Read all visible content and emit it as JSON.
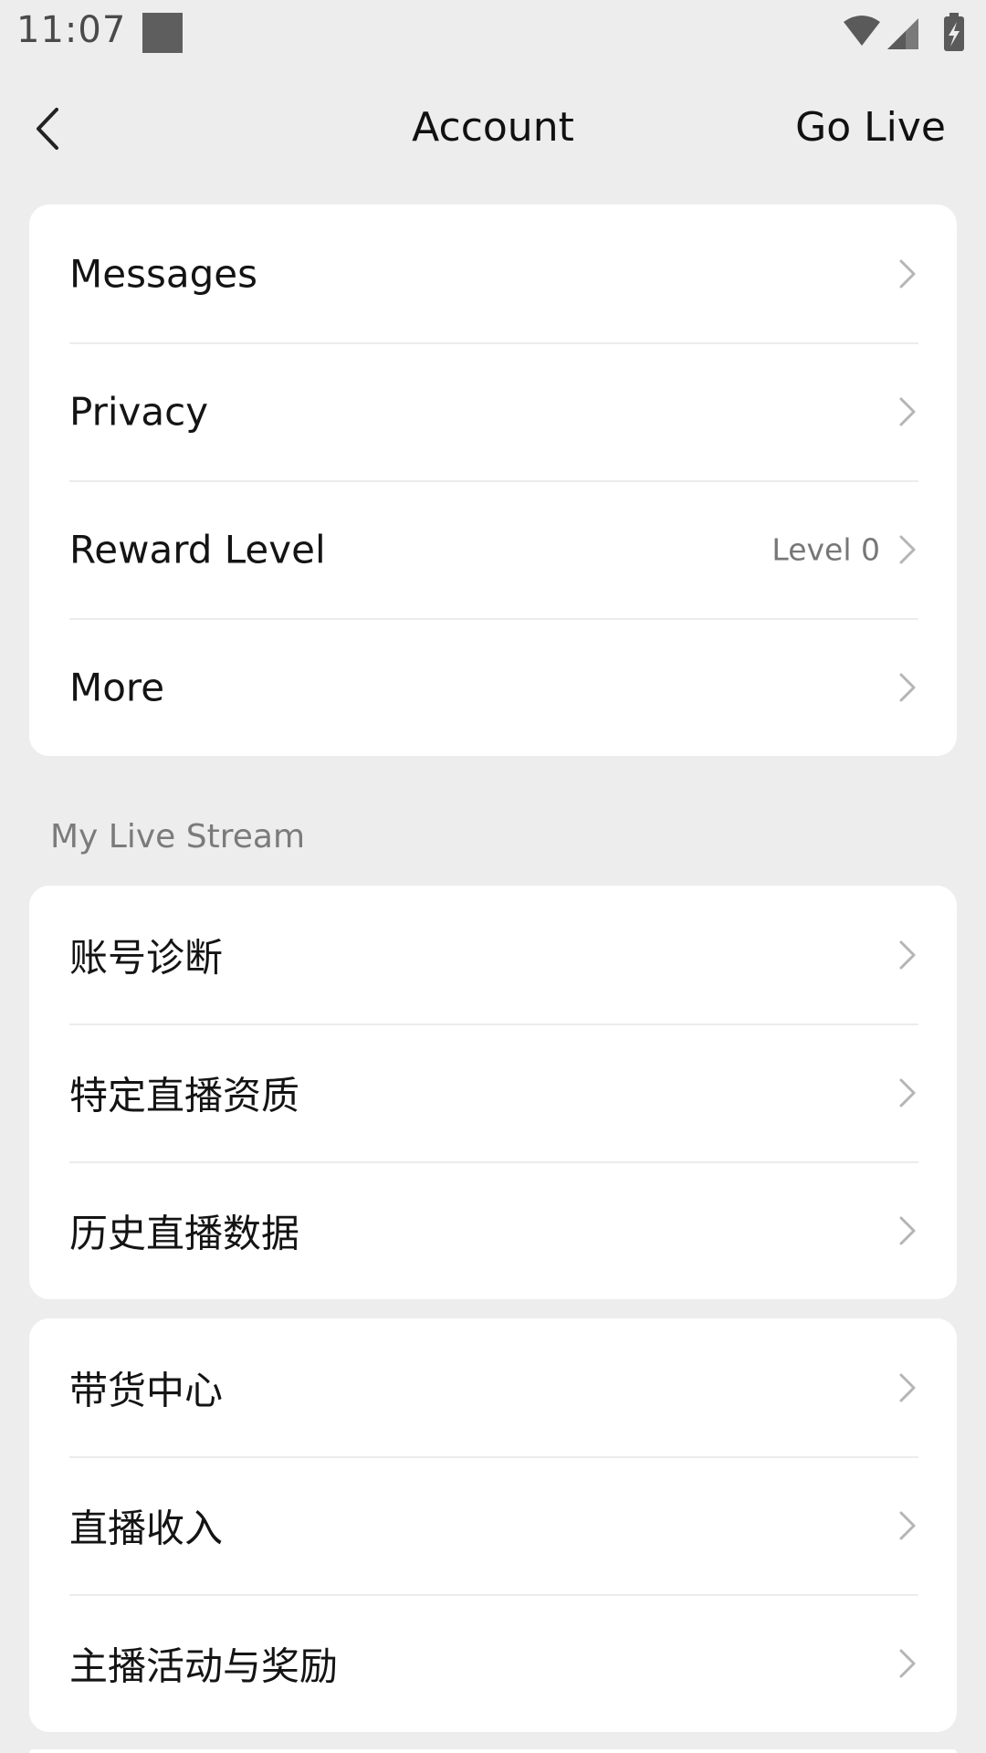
{
  "status_bar": {
    "time": "11:07"
  },
  "nav": {
    "back_icon": "chevron-left-icon",
    "title": "Account",
    "action": "Go Live"
  },
  "account_card": [
    {
      "label": "Messages",
      "value": ""
    },
    {
      "label": "Privacy",
      "value": ""
    },
    {
      "label": "Reward Level",
      "value": "Level 0"
    },
    {
      "label": "More",
      "value": ""
    }
  ],
  "section": {
    "title": "My Live Stream"
  },
  "live_card": [
    {
      "label": "账号诊断"
    },
    {
      "label": "特定直播资质"
    },
    {
      "label": "历史直播数据"
    }
  ],
  "commerce_card": [
    {
      "label": "带货中心"
    },
    {
      "label": "直播收入"
    },
    {
      "label": "主播活动与奖励"
    }
  ],
  "colors": {
    "background": "#ededed",
    "card": "#ffffff",
    "divider": "#ececec",
    "secondary_text": "#7b7b7b"
  }
}
